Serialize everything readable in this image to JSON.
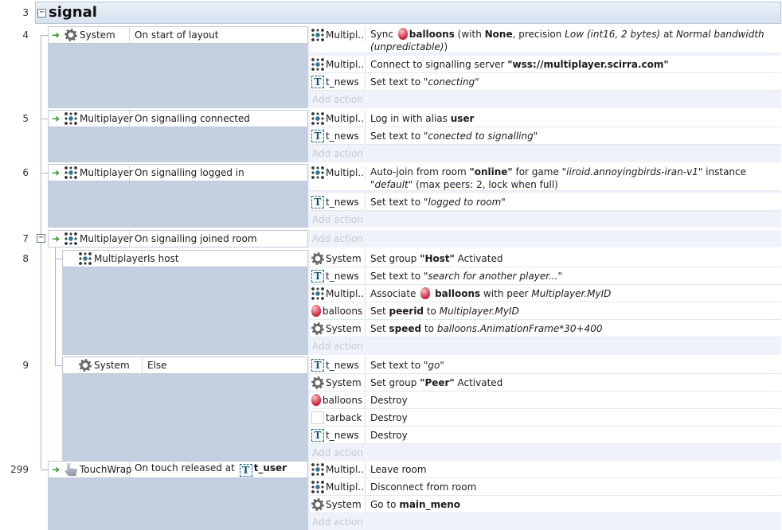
{
  "group": {
    "number": "3",
    "title": "signal",
    "toggle": "−"
  },
  "add_action_label": "Add action",
  "events": {
    "e4": {
      "number": "4",
      "cond_object": "System",
      "cond_text": "On start of layout",
      "actions": [
        {
          "object": "Multipl...",
          "pre": "Sync",
          "obj2": "balloons",
          "mid1": " (with ",
          "b1": "None",
          "mid2": ", precision ",
          "i1": "Low (int16, 2 bytes)",
          "mid3": "  at ",
          "i2": "Normal bandwidth (unpredictable)",
          "post": ")"
        },
        {
          "object": "Multipl...",
          "pre": "Connect to signalling server ",
          "b1": "\"wss://multiplayer.scirra.com\""
        },
        {
          "object": "t_news",
          "pre": "Set text to ",
          "i1": "\"conecting\""
        }
      ]
    },
    "e5": {
      "number": "5",
      "cond_object": "Multiplayer",
      "cond_text": "On signalling connected",
      "actions": [
        {
          "object": "Multipl...",
          "pre": "Log in with alias ",
          "b1": "user"
        },
        {
          "object": "t_news",
          "pre": "Set text to ",
          "i1": "\"conected to signalling\""
        }
      ]
    },
    "e6": {
      "number": "6",
      "cond_object": "Multiplayer",
      "cond_text": "On signalling logged in",
      "actions": [
        {
          "object": "Multipl...",
          "pre": "Auto-join from room ",
          "b1": "\"online\"",
          "mid1": " for game ",
          "i1": "\"iiroid.annoyingbirds-iran-v1\"",
          "mid2": "  instance ",
          "i2": "\"default\"",
          "mid3": " (max peers: 2, lock when full)"
        },
        {
          "object": "t_news",
          "pre": "Set text to ",
          "i1": "\"logged to room\""
        }
      ]
    },
    "e7": {
      "number": "7",
      "toggle": "−",
      "cond_object": "Multiplayer",
      "cond_text": "On signalling joined room"
    },
    "e8": {
      "number": "8",
      "cond_object": "Multiplayer",
      "cond_text": "Is host",
      "actions": [
        {
          "object": "System",
          "pre": "Set group ",
          "b1": "\"Host\"",
          "post": " Activated"
        },
        {
          "object": "t_news",
          "pre": "Set text to ",
          "i1": "\"search for another player...\""
        },
        {
          "object": "Multipl...",
          "pre": "Associate ",
          "obj2": "balloons",
          "post": " with peer ",
          "i1": "Multiplayer.MyID"
        },
        {
          "object": "balloons",
          "pre": "Set ",
          "b1": "peerid",
          "post": " to ",
          "i1": "Multiplayer.MyID"
        },
        {
          "object": "System",
          "pre": "Set ",
          "b1": "speed",
          "post": " to ",
          "i1": "balloons.AnimationFrame*30+400"
        }
      ]
    },
    "e9": {
      "number": "9",
      "cond_object": "System",
      "cond_text": "Else",
      "actions": [
        {
          "object": "t_news",
          "pre": "Set text to ",
          "i1": "\"go\""
        },
        {
          "object": "System",
          "pre": "Set group ",
          "b1": "\"Peer\"",
          "post": " Activated"
        },
        {
          "object": "balloons",
          "pre": "Destroy"
        },
        {
          "object": "tarback",
          "pre": "Destroy"
        },
        {
          "object": "t_news",
          "pre": "Destroy"
        }
      ]
    },
    "e299": {
      "number": "299",
      "cond_object": "TouchWrap",
      "cond_text": "On touch released at",
      "cond_obj2": "t_user",
      "actions": [
        {
          "object": "Multipl...",
          "pre": "Leave room"
        },
        {
          "object": "Multipl...",
          "pre": "Disconnect from room"
        },
        {
          "object": "System",
          "pre": "Go to ",
          "b1": "main_meno"
        }
      ]
    }
  }
}
